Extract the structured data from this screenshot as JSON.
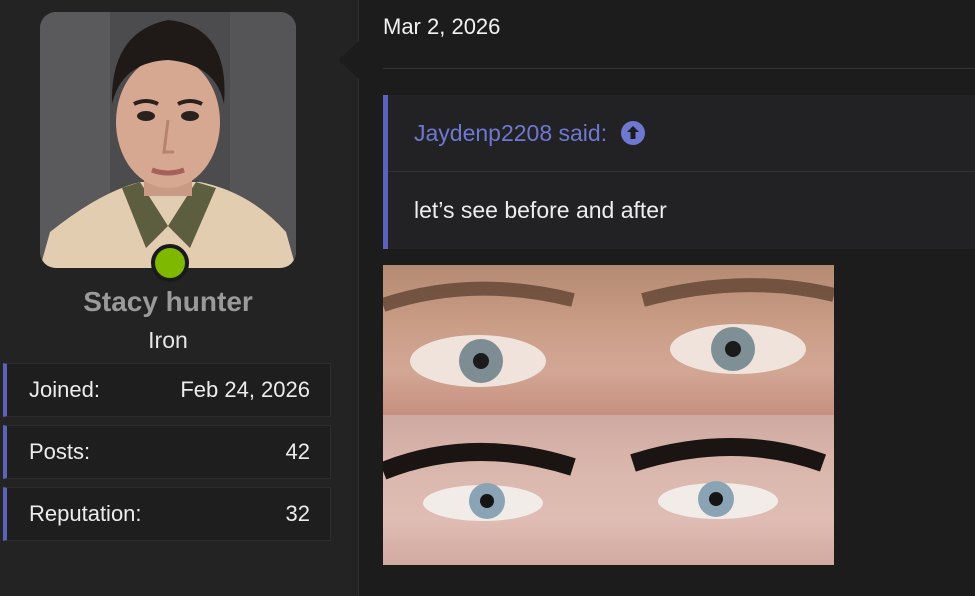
{
  "post": {
    "date": "Mar 2, 2026",
    "quote": {
      "author_line": "Jaydenp2208 said:",
      "text": "let’s see before and after"
    }
  },
  "user": {
    "name": "Stacy hunter",
    "title": "Iron",
    "online": true,
    "stats": [
      {
        "label": "Joined:",
        "value": "Feb 24, 2026"
      },
      {
        "label": "Posts:",
        "value": "42"
      },
      {
        "label": "Reputation:",
        "value": "32"
      }
    ]
  },
  "colors": {
    "accent": "#5b63bd",
    "quote_author": "#6f78d0",
    "online": "#7fb800"
  },
  "icons": {
    "quote_jump": "arrow-up-circle-icon"
  }
}
